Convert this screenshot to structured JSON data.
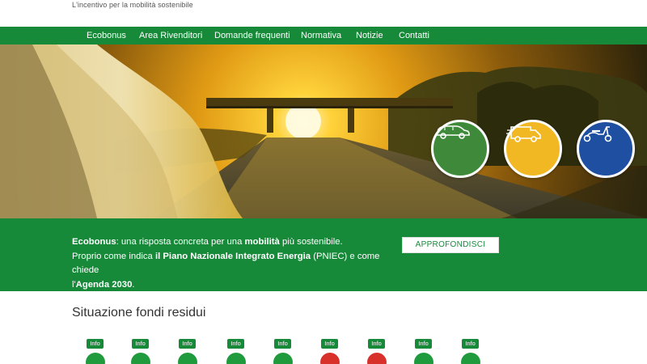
{
  "header": {
    "tagline": "L'incentivo per la mobilità sostenibile"
  },
  "nav": {
    "items": [
      {
        "label": "Ecobonus"
      },
      {
        "label": "Area Rivenditori"
      },
      {
        "label": "Domande frequenti"
      },
      {
        "label": "Normativa"
      },
      {
        "label": "Notizie"
      },
      {
        "label": "Contatti"
      }
    ]
  },
  "hero": {
    "categories": [
      {
        "icon": "car-icon",
        "color": "#3f8a3a"
      },
      {
        "icon": "van-icon",
        "color": "#f2b824"
      },
      {
        "icon": "scooter-icon",
        "color": "#1f4fa0"
      }
    ]
  },
  "banner": {
    "line1": {
      "t1": "Ecobonus",
      "t2": ": una risposta concreta per una ",
      "t3": "mobilità",
      "t4": " più sostenibile."
    },
    "line2": {
      "t1": "Proprio come indica ",
      "t2": "il Piano Nazionale Integrato Energia",
      "t3": " (PNIEC) e come chiede"
    },
    "line3": {
      "t1": "l'",
      "t2": "Agenda 2030",
      "t3": "."
    },
    "button_label": "APPROFONDISCI"
  },
  "funds": {
    "title": "Situazione fondi residui",
    "items": [
      {
        "info_label": "Info",
        "status": "green"
      },
      {
        "info_label": "Info",
        "status": "green"
      },
      {
        "info_label": "Info",
        "status": "green"
      },
      {
        "info_label": "Info",
        "status": "green"
      },
      {
        "info_label": "Info",
        "status": "green"
      },
      {
        "info_label": "Info",
        "status": "red"
      },
      {
        "info_label": "Info",
        "status": "red"
      },
      {
        "info_label": "Info",
        "status": "green"
      },
      {
        "info_label": "Info",
        "status": "green"
      }
    ],
    "colors": {
      "green": "#1f9a3c",
      "red": "#d8312b"
    }
  },
  "colors": {
    "brand_green": "#178a3a"
  }
}
